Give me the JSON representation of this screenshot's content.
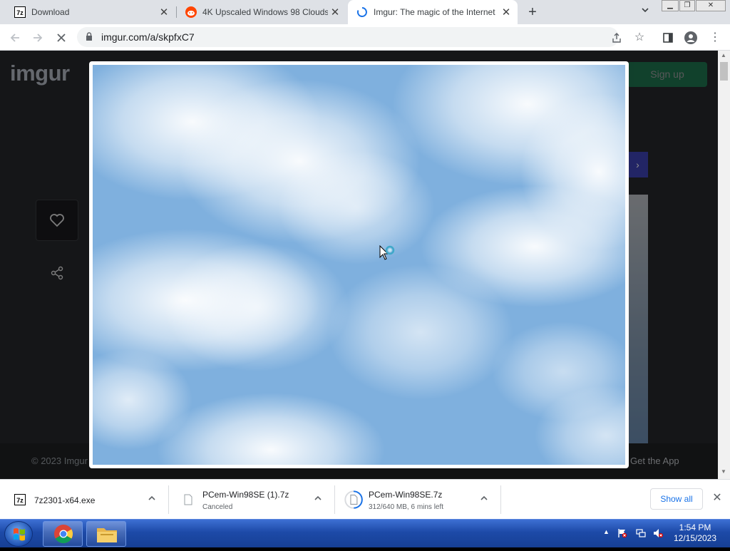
{
  "browser": {
    "tabs": [
      {
        "title": "Download",
        "favicon": "7zip-icon",
        "active": false
      },
      {
        "title": "4K Upscaled Windows 98 Clouds",
        "favicon": "reddit-icon",
        "active": false
      },
      {
        "title": "Imgur: The magic of the Internet",
        "favicon": "loading-spinner-icon",
        "active": true
      }
    ],
    "new_tab_symbol": "+",
    "url": "imgur.com/a/skpfxC7"
  },
  "page": {
    "logo_text": "imgur",
    "signup_label": "Sign up",
    "copyright": "© 2023 Imgur",
    "get_app": "Get the App",
    "next_symbol": "›"
  },
  "downloads": {
    "items": [
      {
        "name": "7z2301-x64.exe",
        "status": ""
      },
      {
        "name": "PCem-Win98SE (1).7z",
        "status": "Canceled"
      },
      {
        "name": "PCem-Win98SE.7z",
        "status": "312/640 MB, 6 mins left"
      }
    ],
    "show_all_label": "Show all"
  },
  "taskbar": {
    "time": "1:54 PM",
    "date": "12/15/2023"
  },
  "colors": {
    "imgur_green": "#1bb76e",
    "sky_blue": "#7fb0de",
    "taskbar_blue": "#1d4aa8"
  }
}
